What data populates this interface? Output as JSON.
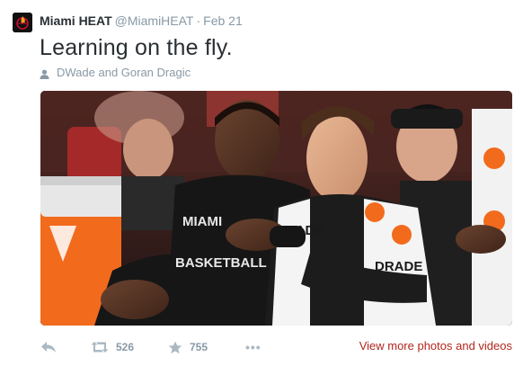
{
  "tweet": {
    "full_name": "Miami HEAT",
    "handle": "@MiamiHEAT",
    "separator": "·",
    "time": "Feb 21",
    "text": "Learning on the fly.",
    "tagged": "DWade and Goran Dragic",
    "photo_jersey_text_1": "MIAMI",
    "photo_jersey_text_2": "BASKETBALL",
    "photo_towel_text_1": "DRADE",
    "photo_towel_text_2": "DRADE"
  },
  "actions": {
    "retweet_count": "526",
    "favorite_count": "755",
    "more_label": "•••",
    "view_more_label": "View more photos and videos"
  },
  "icons": {
    "avatar": "heat-logo-icon",
    "tagged": "person-icon",
    "reply": "reply-icon",
    "retweet": "retweet-icon",
    "favorite": "star-icon",
    "more": "more-icon"
  },
  "colors": {
    "link": "#b3261e",
    "muted": "#8899a6",
    "text": "#292f33"
  }
}
